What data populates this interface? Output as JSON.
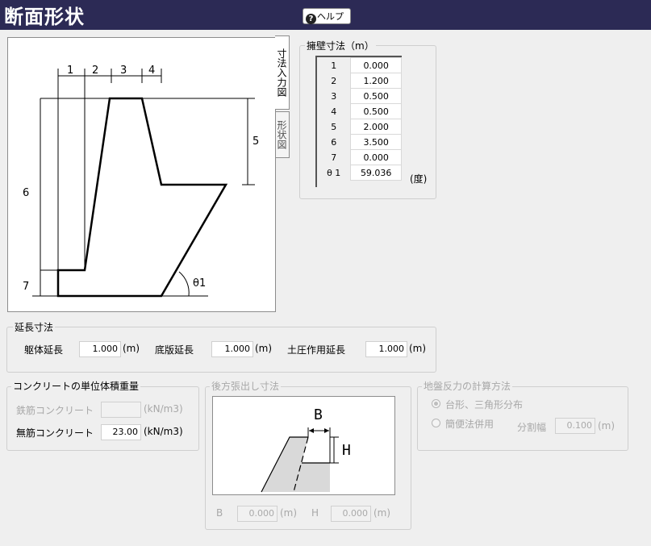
{
  "window": {
    "title": "断面形状",
    "help_label": "ヘルプ"
  },
  "tabs": {
    "dimension": "寸法入力図",
    "shape": "形状図"
  },
  "diagram": {
    "labels": [
      "1",
      "2",
      "3",
      "4",
      "5",
      "6",
      "7"
    ],
    "angle_label": "θ1"
  },
  "wall_dimensions": {
    "legend": "擁壁寸法（m）",
    "rows": [
      {
        "key": "1",
        "value": "0.000"
      },
      {
        "key": "2",
        "value": "1.200"
      },
      {
        "key": "3",
        "value": "0.500"
      },
      {
        "key": "4",
        "value": "0.500"
      },
      {
        "key": "5",
        "value": "2.000"
      },
      {
        "key": "6",
        "value": "3.500"
      },
      {
        "key": "7",
        "value": "0.000"
      },
      {
        "key": "θ 1",
        "value": "59.036"
      }
    ],
    "angle_unit": "(度)"
  },
  "extension": {
    "legend": "延長寸法",
    "body_label": "躯体延長",
    "body_value": "1.000",
    "base_label": "底版延長",
    "base_value": "1.000",
    "earth_label": "土圧作用延長",
    "earth_value": "1.000",
    "unit": "(m)"
  },
  "concrete": {
    "legend": "コンクリートの単位体積重量",
    "rebar_label": "鉄筋コンクリート",
    "rebar_value": "",
    "plain_label": "無筋コンクリート",
    "plain_value": "23.00",
    "unit": "(kN/m3)"
  },
  "rear": {
    "legend": "後方張出し寸法",
    "b_label": "B",
    "b_value": "0.000",
    "h_label": "H",
    "h_value": "0.000",
    "unit": "(m)"
  },
  "reaction": {
    "legend": "地盤反力の計算方法",
    "option1": "台形、三角形分布",
    "option2": "簡便法併用",
    "division_label": "分割幅",
    "division_value": "0.100",
    "unit": "(m)"
  }
}
